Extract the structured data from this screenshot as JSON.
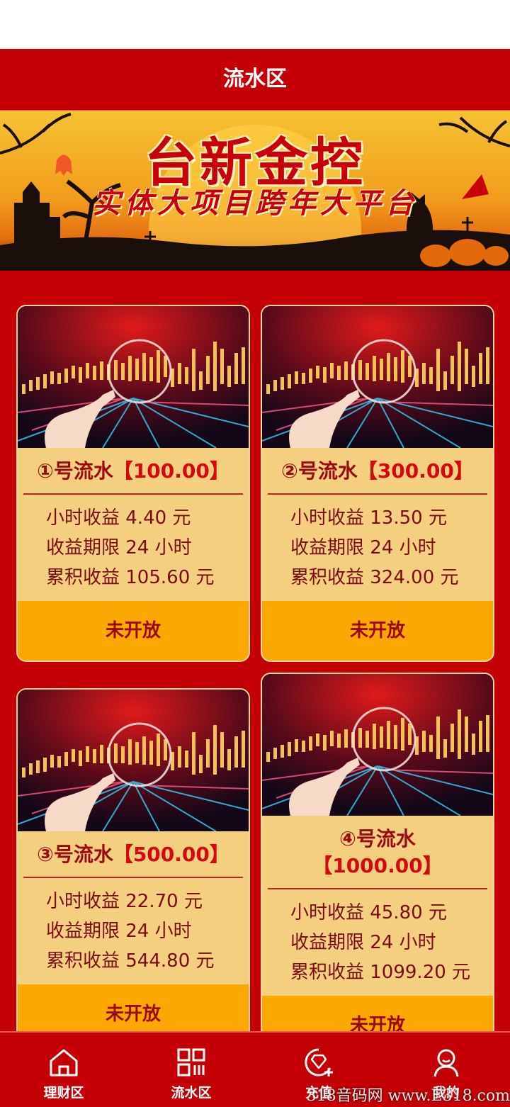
{
  "header": {
    "title": "流水区"
  },
  "banner": {
    "title": "台新金控",
    "subtitle": "实体大项目跨年大平台"
  },
  "products": [
    {
      "num": "①",
      "name_prefix": "号流水",
      "amount": "【100.00】",
      "hourly": "小时收益 4.40 元",
      "period": "收益期限 24 小时",
      "total": "累积收益 105.60 元",
      "status": "未开放"
    },
    {
      "num": "②",
      "name_prefix": "号流水",
      "amount": "【300.00】",
      "hourly": "小时收益 13.50 元",
      "period": "收益期限 24 小时",
      "total": "累积收益 324.00 元",
      "status": "未开放"
    },
    {
      "num": "③",
      "name_prefix": "号流水",
      "amount": "【500.00】",
      "hourly": "小时收益 22.70 元",
      "period": "收益期限 24 小时",
      "total": "累积收益 544.80 元",
      "status": "未开放"
    },
    {
      "num": "④",
      "name_prefix": "号流水",
      "amount": "【1000.00】",
      "hourly": "小时收益 45.80 元",
      "period": "收益期限 24 小时",
      "total": "累积收益 1099.20 元",
      "status": "未开放"
    }
  ],
  "tabs": [
    {
      "label": "理财区",
      "icon": "home-icon"
    },
    {
      "label": "流水区",
      "icon": "grid-icon"
    },
    {
      "label": "充值",
      "icon": "diamond-plus-icon"
    },
    {
      "label": "我的",
      "icon": "user-icon"
    }
  ],
  "watermark": "318音码网 www.E318.com"
}
